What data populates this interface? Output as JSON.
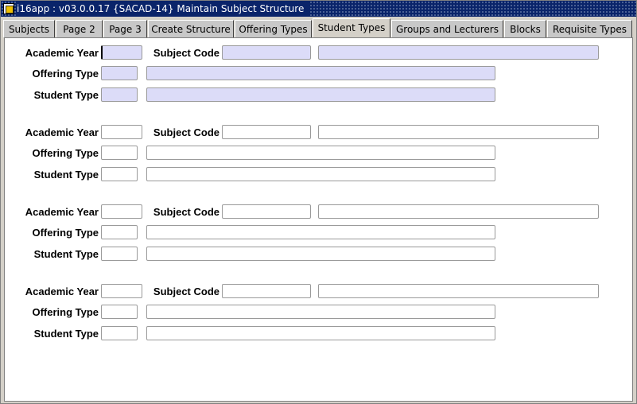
{
  "window": {
    "title": "i16app : v03.0.0.17  {SACAD-14} Maintain Subject Structure"
  },
  "tabs": [
    {
      "label": "Subjects",
      "active": false
    },
    {
      "label": "Page 2",
      "active": false
    },
    {
      "label": "Page 3",
      "active": false
    },
    {
      "label": "Create Structure",
      "active": false
    },
    {
      "label": "Offering Types",
      "active": false
    },
    {
      "label": "Student Types",
      "active": true
    },
    {
      "label": "Groups and Lecturers",
      "active": false
    },
    {
      "label": "Blocks",
      "active": false
    },
    {
      "label": "Requisite Types",
      "active": false
    }
  ],
  "labels": {
    "academic_year": "Academic Year",
    "subject_code": "Subject Code",
    "offering_type": "Offering Type",
    "student_type": "Student Type"
  },
  "records": [
    {
      "academic_year": "",
      "subject_code": "",
      "subject_name": "",
      "offering_type": "",
      "offering_desc": "",
      "student_type": "",
      "student_desc": ""
    },
    {
      "academic_year": "",
      "subject_code": "",
      "subject_name": "",
      "offering_type": "",
      "offering_desc": "",
      "student_type": "",
      "student_desc": ""
    },
    {
      "academic_year": "",
      "subject_code": "",
      "subject_name": "",
      "offering_type": "",
      "offering_desc": "",
      "student_type": "",
      "student_desc": ""
    },
    {
      "academic_year": "",
      "subject_code": "",
      "subject_name": "",
      "offering_type": "",
      "offering_desc": "",
      "student_type": "",
      "student_desc": ""
    }
  ],
  "colors": {
    "highlight_field": "#dcdcf8",
    "title_bar": "#0a246a",
    "panel": "#ffffff",
    "chrome": "#d4d0c8"
  }
}
